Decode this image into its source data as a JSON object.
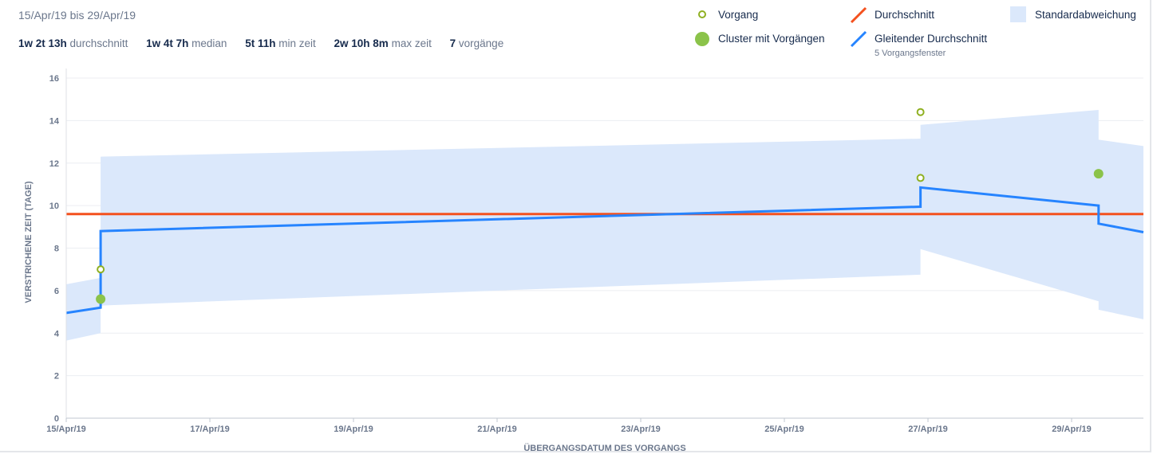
{
  "header": {
    "date_range": "15/Apr/19 bis 29/Apr/19",
    "stats": [
      {
        "value": "1w 2t 13h",
        "label": "durchschnitt"
      },
      {
        "value": "1w 4t 7h",
        "label": "median"
      },
      {
        "value": "5t 11h",
        "label": "min zeit"
      },
      {
        "value": "2w 10h 8m",
        "label": "max zeit"
      },
      {
        "value": "7",
        "label": "vorgänge"
      }
    ]
  },
  "legend": {
    "issue": "Vorgang",
    "cluster": "Cluster mit Vorgängen",
    "average": "Durchschnitt",
    "rolling": "Gleitender Durchschnitt",
    "rolling_sub": "5 Vorgangsfenster",
    "stddev": "Standardabweichung"
  },
  "colors": {
    "issue": "#8fb021",
    "cluster": "#8bc34a",
    "average": "#f4511e",
    "rolling": "#2684ff",
    "stddev": "#dbe8fb"
  },
  "chart_data": {
    "type": "scatter",
    "xlabel": "ÜBERGANGSDATUM DES VORGANGS",
    "ylabel": "VERSTRICHENE ZEIT (TAGE)",
    "xlim": [
      "2019-04-15",
      "2019-04-30"
    ],
    "ylim": [
      0,
      16
    ],
    "x_ticks": [
      "15/Apr/19",
      "17/Apr/19",
      "19/Apr/19",
      "21/Apr/19",
      "23/Apr/19",
      "25/Apr/19",
      "27/Apr/19",
      "29/Apr/19"
    ],
    "y_ticks": [
      0,
      2,
      4,
      6,
      8,
      10,
      12,
      14,
      16
    ],
    "grid": true,
    "legend_position": "top-right",
    "issues": [
      {
        "x": "2019-04-15T11:30",
        "y": 7.0
      },
      {
        "x": "2019-04-26T21:30",
        "y": 14.4
      },
      {
        "x": "2019-04-26T21:30",
        "y": 11.3
      }
    ],
    "clusters": [
      {
        "x": "2019-04-15T11:30",
        "y": 5.6
      },
      {
        "x": "2019-04-29T09:00",
        "y": 11.5
      }
    ],
    "average": 9.6,
    "rolling_average": [
      {
        "x": "2019-04-15T00:00",
        "y": 4.95
      },
      {
        "x": "2019-04-15T11:30",
        "y": 5.2
      },
      {
        "x": "2019-04-15T11:30",
        "y": 8.8
      },
      {
        "x": "2019-04-26T21:30",
        "y": 9.95
      },
      {
        "x": "2019-04-26T21:30",
        "y": 10.85
      },
      {
        "x": "2019-04-29T09:00",
        "y": 10.0
      },
      {
        "x": "2019-04-29T09:00",
        "y": 9.15
      },
      {
        "x": "2019-04-30T00:00",
        "y": 8.75
      }
    ],
    "std_band": [
      {
        "x": "2019-04-15T00:00",
        "upper": 6.3,
        "lower": 3.65
      },
      {
        "x": "2019-04-15T11:30",
        "upper": 6.6,
        "lower": 4.0
      },
      {
        "x": "2019-04-15T11:30",
        "upper": 12.3,
        "lower": 5.3
      },
      {
        "x": "2019-04-26T21:30",
        "upper": 13.15,
        "lower": 6.75
      },
      {
        "x": "2019-04-26T21:30",
        "upper": 13.8,
        "lower": 7.95
      },
      {
        "x": "2019-04-29T09:00",
        "upper": 14.5,
        "lower": 5.5
      },
      {
        "x": "2019-04-29T09:00",
        "upper": 13.1,
        "lower": 5.1
      },
      {
        "x": "2019-04-30T00:00",
        "upper": 12.8,
        "lower": 4.65
      }
    ]
  }
}
